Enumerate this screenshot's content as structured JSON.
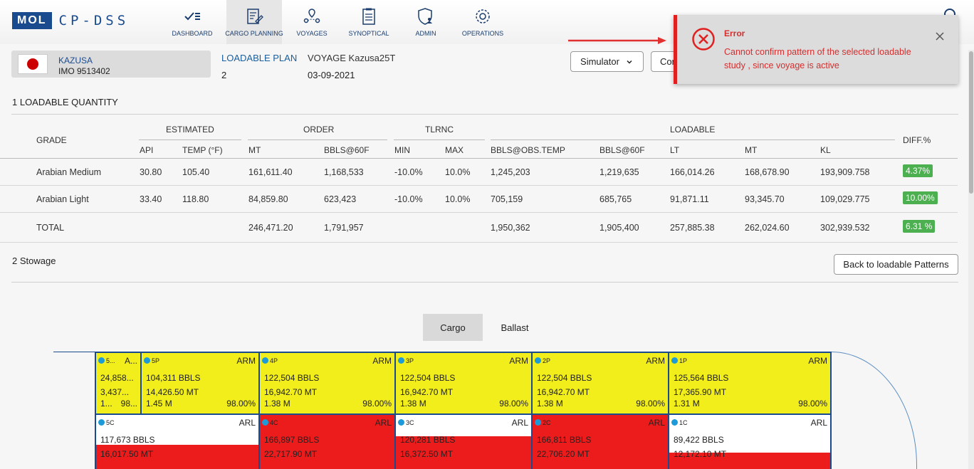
{
  "brand": {
    "logo_box": "MOL",
    "logo_text": "CP-DSS"
  },
  "nav": [
    {
      "label": "DASHBOARD",
      "icon": "dashboard-icon"
    },
    {
      "label": "CARGO PLANNING",
      "icon": "cargo-planning-icon",
      "active": true
    },
    {
      "label": "VOYAGES",
      "icon": "voyages-icon"
    },
    {
      "label": "SYNOPTICAL",
      "icon": "synoptical-icon"
    },
    {
      "label": "ADMIN",
      "icon": "admin-icon"
    },
    {
      "label": "OPERATIONS",
      "icon": "operations-icon"
    }
  ],
  "vessel": {
    "name": "KAZUSA",
    "imo": "IMO 9513402"
  },
  "plan": {
    "label": "LOADABLE PLAN",
    "value": "2"
  },
  "voyage": {
    "label": "VOYAGE Kazusa25T",
    "date": "03-09-2021"
  },
  "buttons": {
    "simulator": "Simulator",
    "confirm": "Confirm",
    "back": "Back to loadable Patterns"
  },
  "sections": {
    "quantity": "1 LOADABLE QUANTITY",
    "stowage": "2 Stowage"
  },
  "table": {
    "group_headers": {
      "estimated": "ESTIMATED",
      "order": "ORDER",
      "tlrnc": "TLRNC",
      "loadable": "LOADABLE"
    },
    "headers": {
      "grade": "GRADE",
      "api": "API",
      "temp": "TEMP (°F)",
      "order_mt": "MT",
      "order_bbls": "BBLS@60F",
      "min": "MIN",
      "max": "MAX",
      "obs": "BBLS@OBS.TEMP",
      "bbls60": "BBLS@60F",
      "lt": "LT",
      "mt": "MT",
      "kl": "KL",
      "diff": "DIFF.%"
    },
    "rows": [
      {
        "grade": "Arabian Medium",
        "api": "30.80",
        "temp": "105.40",
        "order_mt": "161,611.40",
        "order_bbls": "1,168,533",
        "min": "-10.0%",
        "max": "10.0%",
        "obs": "1,245,203",
        "bbls60": "1,219,635",
        "lt": "166,014.26",
        "mt": "168,678.90",
        "kl": "193,909.758",
        "diff": "4.37%"
      },
      {
        "grade": "Arabian Light",
        "api": "33.40",
        "temp": "118.80",
        "order_mt": "84,859.80",
        "order_bbls": "623,423",
        "min": "-10.0%",
        "max": "10.0%",
        "obs": "705,159",
        "bbls60": "685,765",
        "lt": "91,871.11",
        "mt": "93,345.70",
        "kl": "109,029.775",
        "diff": "10.00%"
      },
      {
        "grade": "TOTAL",
        "api": "",
        "temp": "",
        "order_mt": "246,471.20",
        "order_bbls": "1,791,957",
        "min": "",
        "max": "",
        "obs": "1,950,362",
        "bbls60": "1,905,400",
        "lt": "257,885.38",
        "mt": "262,024.60",
        "kl": "302,939.532",
        "diff": "6.31 %"
      }
    ]
  },
  "tabs": {
    "cargo": "Cargo",
    "ballast": "Ballast"
  },
  "tanks_top": [
    {
      "id": "5...",
      "grade": "A...",
      "bbls": "24,858...",
      "mt": "3,437...",
      "m": "1...",
      "pct": "98..."
    },
    {
      "id": "5P",
      "grade": "ARM",
      "bbls": "104,311 BBLS",
      "mt": "14,426.50 MT",
      "m": "1.45 M",
      "pct": "98.00%"
    },
    {
      "id": "4P",
      "grade": "ARM",
      "bbls": "122,504 BBLS",
      "mt": "16,942.70 MT",
      "m": "1.38 M",
      "pct": "98.00%"
    },
    {
      "id": "3P",
      "grade": "ARM",
      "bbls": "122,504 BBLS",
      "mt": "16,942.70 MT",
      "m": "1.38 M",
      "pct": "98.00%"
    },
    {
      "id": "2P",
      "grade": "ARM",
      "bbls": "122,504 BBLS",
      "mt": "16,942.70 MT",
      "m": "1.38 M",
      "pct": "98.00%"
    },
    {
      "id": "1P",
      "grade": "ARM",
      "bbls": "125,564 BBLS",
      "mt": "17,365.90 MT",
      "m": "1.31 M",
      "pct": "98.00%"
    }
  ],
  "tanks_bottom": [
    {
      "id": "5C",
      "grade": "ARL",
      "bbls": "117,673 BBLS",
      "mt": "16,017.50 MT",
      "fill_fraction": 0.45
    },
    {
      "id": "4C",
      "grade": "ARL",
      "bbls": "166,897 BBLS",
      "mt": "22,717.90 MT",
      "fill_fraction": 1.0
    },
    {
      "id": "3C",
      "grade": "ARL",
      "bbls": "120,281 BBLS",
      "mt": "16,372.50 MT",
      "fill_fraction": 0.6
    },
    {
      "id": "2C",
      "grade": "ARL",
      "bbls": "166,811 BBLS",
      "mt": "22,706.20 MT",
      "fill_fraction": 1.0
    },
    {
      "id": "1C",
      "grade": "ARL",
      "bbls": "89,422 BBLS",
      "mt": "12,172.10 MT",
      "fill_fraction": 0.3
    }
  ],
  "toast": {
    "title": "Error",
    "message": "Cannot confirm pattern of the selected loadable study , since voyage is active"
  },
  "colors": {
    "brand": "#1a4b8f",
    "error": "#e02020",
    "tank_yellow": "#f2ee1c",
    "tank_red": "#ed1c1c",
    "diff_green": "#4caf50"
  }
}
